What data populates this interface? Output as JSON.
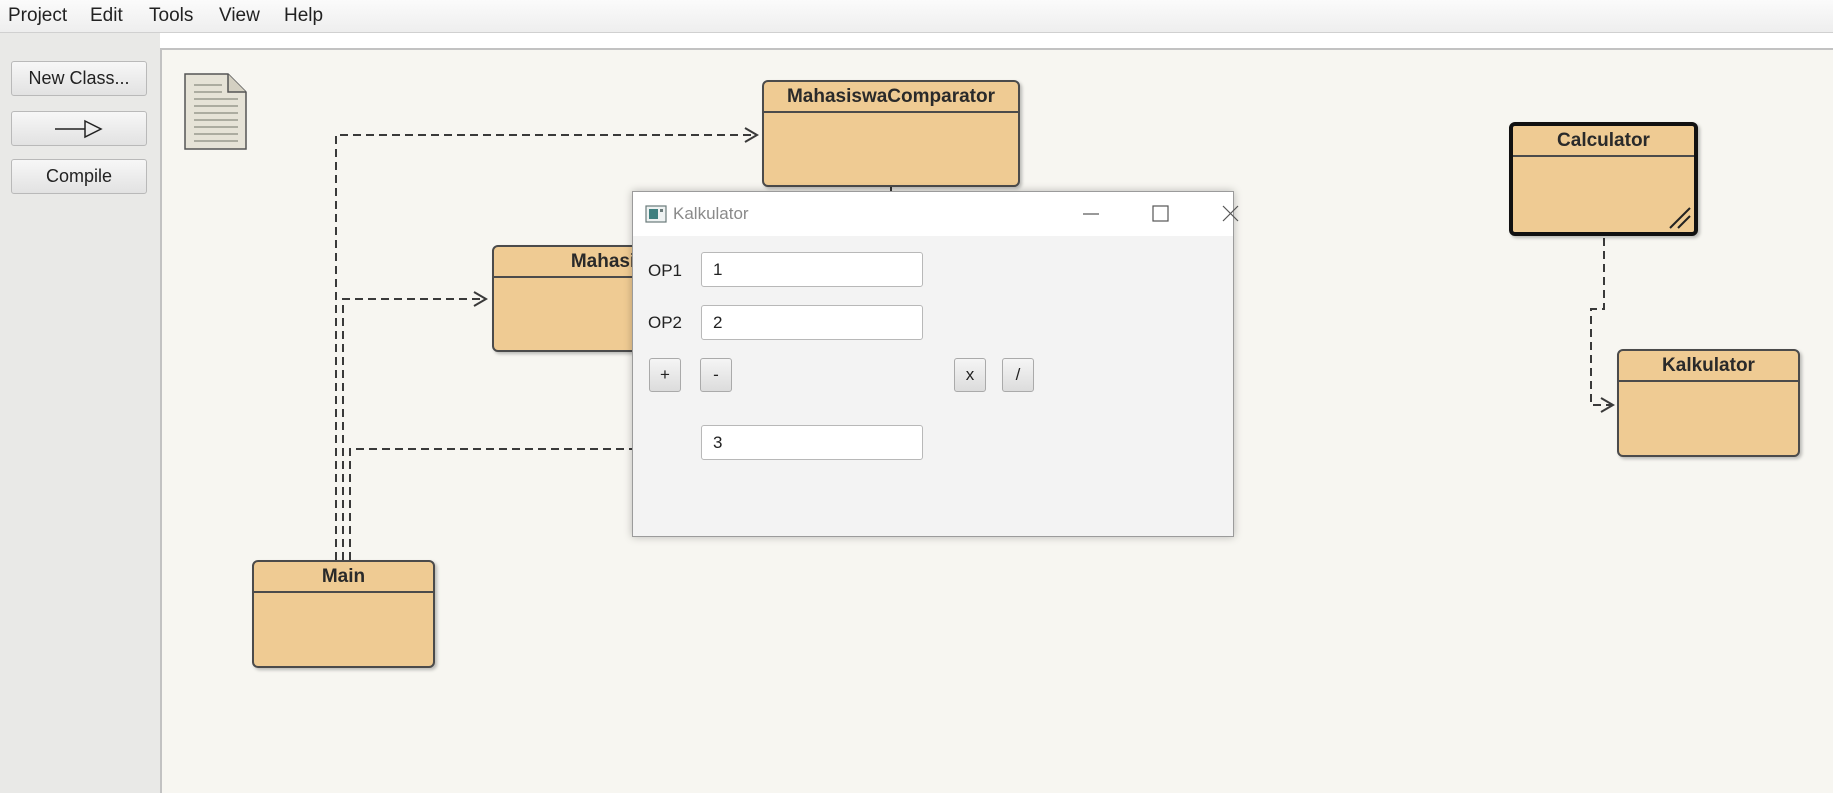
{
  "menu": [
    "Project",
    "Edit",
    "Tools",
    "View",
    "Help"
  ],
  "toolbar": {
    "new_class_label": "New Class...",
    "compile_label": "Compile"
  },
  "classes": {
    "comparator": "MahasiswaComparator",
    "mahasiswa": "Mahasiswa",
    "main": "Main",
    "calculator": "Calculator",
    "kalkulator": "Kalkulator"
  },
  "dialog": {
    "title": "Kalkulator",
    "op1_label": "OP1",
    "op2_label": "OP2",
    "op1_value": "1",
    "op2_value": "2",
    "result_value": "3",
    "buttons": {
      "add": "+",
      "subtract": "-",
      "multiply": "x",
      "divide": "/"
    }
  },
  "colors": {
    "class_fill": "#efcb93",
    "canvas_bg": "#f7f6f1",
    "panel_bg": "#e9e9e7"
  }
}
